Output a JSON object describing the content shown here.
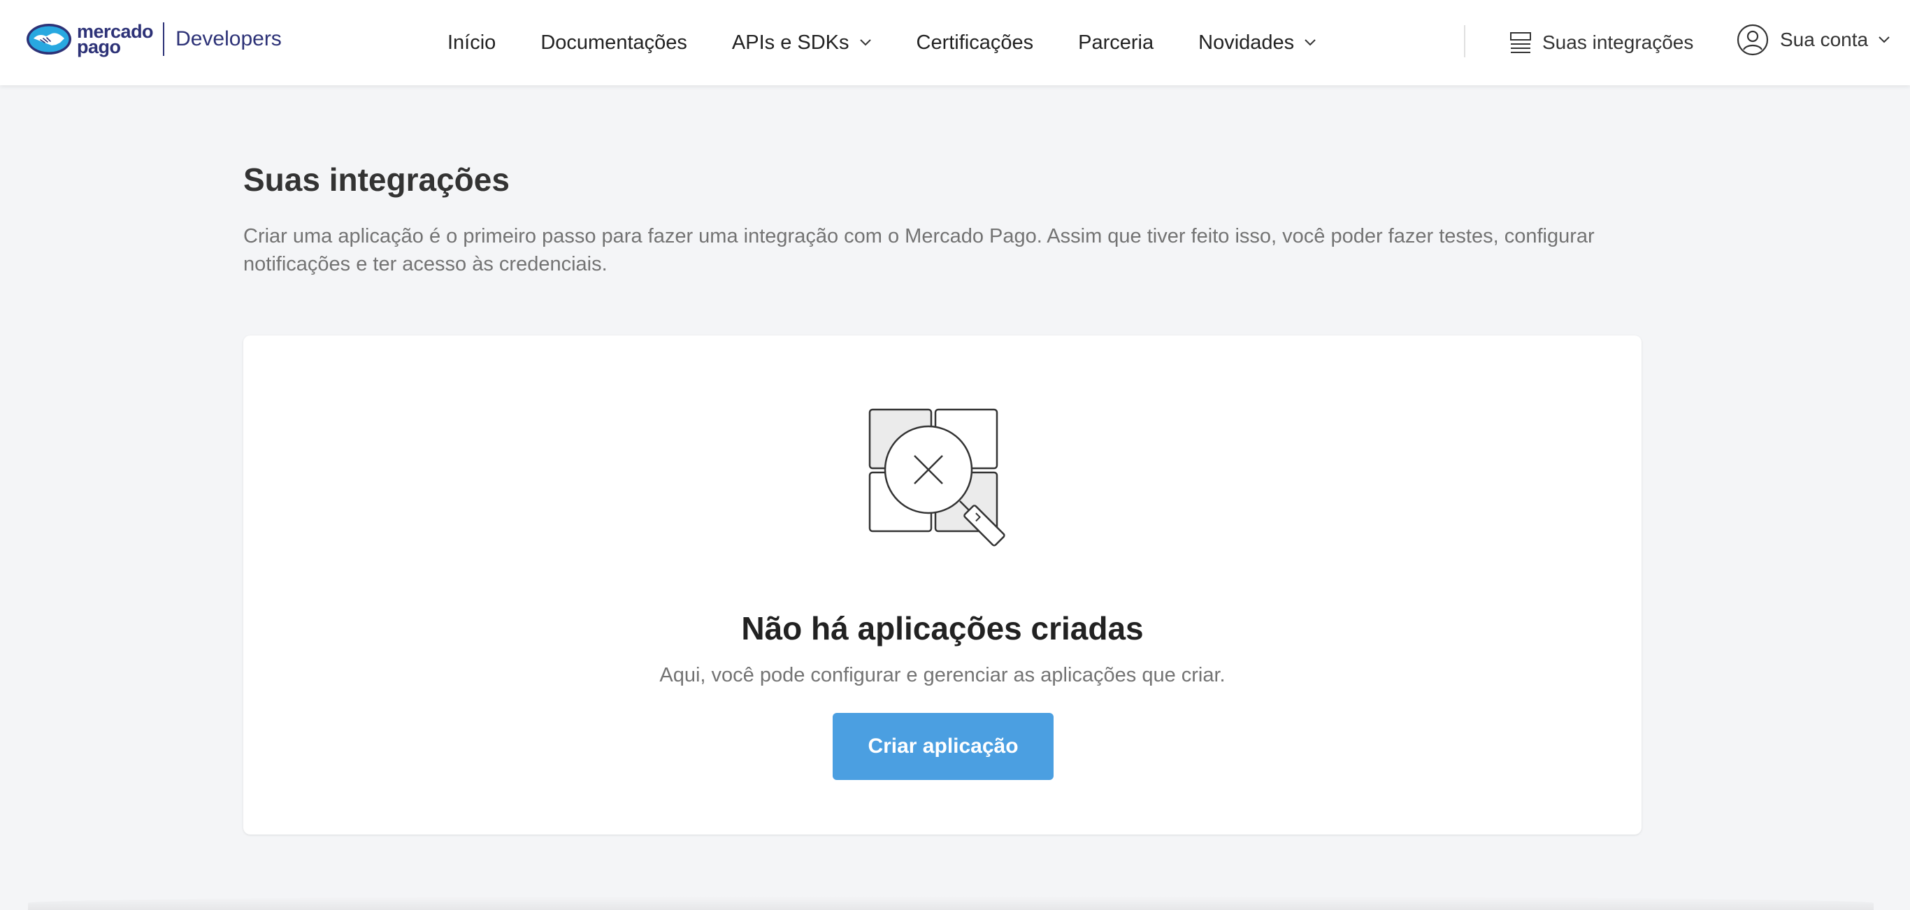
{
  "header": {
    "brand": {
      "wordmark_line1": "mercado",
      "wordmark_line2": "pago",
      "developers_label": "Developers",
      "colors": {
        "navy": "#2d3277",
        "sky": "#28a8e0"
      }
    },
    "nav": {
      "items": [
        {
          "label": "Início",
          "has_dropdown": false
        },
        {
          "label": "Documentações",
          "has_dropdown": false
        },
        {
          "label": "APIs e SDKs",
          "has_dropdown": true
        },
        {
          "label": "Certificações",
          "has_dropdown": false
        },
        {
          "label": "Parceria",
          "has_dropdown": false
        },
        {
          "label": "Novidades",
          "has_dropdown": true
        }
      ]
    },
    "integrations_link": {
      "label": "Suas integrações",
      "icon": "list-icon"
    },
    "account": {
      "label": "Sua conta",
      "icon": "user-circle-icon"
    }
  },
  "main": {
    "title": "Suas integrações",
    "description": "Criar uma aplicação é o primeiro passo para fazer uma integração com o Mercado Pago. Assim que tiver feito isso, você poder fazer testes, configurar notificações e ter acesso às credenciais.",
    "empty_state": {
      "icon": "no-results-magnifier-icon",
      "title": "Não há aplicações criadas",
      "subtitle": "Aqui, você pode configurar e gerenciar as aplicações que criar.",
      "button_label": "Criar aplicação",
      "button_color": "#4b9fe1"
    }
  }
}
